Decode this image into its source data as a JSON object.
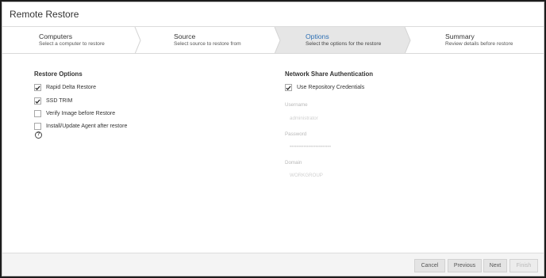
{
  "dialog": {
    "title": "Remote Restore"
  },
  "steps": [
    {
      "name": "Computers",
      "desc": "Select a computer to restore"
    },
    {
      "name": "Source",
      "desc": "Select source to restore from"
    },
    {
      "name": "Options",
      "desc": "Select the options for the restore"
    },
    {
      "name": "Summary",
      "desc": "Review details before restore"
    }
  ],
  "colors": {
    "active_step_bg": "#e6e6e6",
    "active_step_text": "#2d6fb3",
    "checkbox_border": "#a8a8a8"
  },
  "restore_options": {
    "title": "Restore Options",
    "items": [
      {
        "label": "Rapid Delta Restore",
        "checked": true
      },
      {
        "label": "SSD TRIM",
        "checked": true
      },
      {
        "label": "Verify Image before Restore",
        "checked": false
      },
      {
        "label": "Install/Update Agent after restore",
        "checked": false
      }
    ],
    "help_glyph": "?"
  },
  "network_auth": {
    "title": "Network Share Authentication",
    "use_repo": {
      "label": "Use Repository Credentials",
      "checked": true
    },
    "username": {
      "label": "Username",
      "value": "administrator"
    },
    "password": {
      "label": "Password",
      "value": "••••••••••••••••••••••••"
    },
    "domain": {
      "label": "Domain",
      "value": "WORKGROUP"
    }
  },
  "footer": {
    "cancel": "Cancel",
    "previous": "Previous",
    "next": "Next",
    "finish": "Finish"
  }
}
